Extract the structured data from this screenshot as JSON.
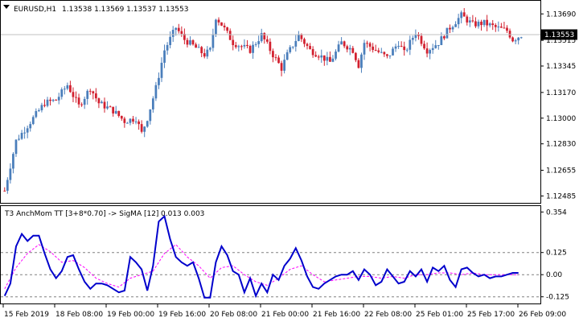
{
  "main_chart": {
    "symbol_label": "EURUSD,H1",
    "ohlc": "1.13538 1.13569 1.13537 1.13553",
    "price_min": 1.1245,
    "price_max": 1.1375,
    "price_ticks": [
      "1.13690",
      "1.13515",
      "1.13345",
      "1.13170",
      "1.13000",
      "1.12830",
      "1.12655",
      "1.12485"
    ],
    "current_price_label": "1.13553",
    "current_price": 1.13553,
    "bull_color": "#4a7ebb",
    "bear_color": "#d2202f"
  },
  "indicator": {
    "name": "T3 AnchMom TT [3+8*0.70] -> SigMA [12]",
    "values_text": "0.013 0.003",
    "levels": [
      "0.354",
      "0.125",
      "0.00",
      "-0.125"
    ],
    "main_color": "#0000cc",
    "signal_color": "#ff00ff"
  },
  "time_axis": {
    "labels": [
      "15 Feb 2019",
      "18 Feb 08:00",
      "19 Feb 00:00",
      "19 Feb 16:00",
      "20 Feb 08:00",
      "21 Feb 00:00",
      "21 Feb 16:00",
      "22 Feb 08:00",
      "25 Feb 01:00",
      "25 Feb 17:00",
      "26 Feb 09:00"
    ]
  },
  "chart_data": [
    {
      "type": "candlestick",
      "title": "EURUSD,H1",
      "ylim": [
        1.1245,
        1.1375
      ],
      "close_path": [
        [
          0,
          1.1252
        ],
        [
          4,
          1.1285
        ],
        [
          10,
          1.13
        ],
        [
          14,
          1.131
        ],
        [
          18,
          1.1312
        ],
        [
          22,
          1.1322
        ],
        [
          26,
          1.1308
        ],
        [
          30,
          1.132
        ],
        [
          33,
          1.131
        ],
        [
          38,
          1.1305
        ],
        [
          42,
          1.1298
        ],
        [
          46,
          1.13
        ],
        [
          48,
          1.129
        ],
        [
          50,
          1.13
        ],
        [
          53,
          1.132
        ],
        [
          56,
          1.1345
        ],
        [
          60,
          1.136
        ],
        [
          63,
          1.1352
        ],
        [
          66,
          1.1348
        ],
        [
          70,
          1.1342
        ],
        [
          72,
          1.1345
        ],
        [
          74,
          1.1367
        ],
        [
          76,
          1.1362
        ],
        [
          80,
          1.135
        ],
        [
          86,
          1.1345
        ],
        [
          90,
          1.1355
        ],
        [
          94,
          1.1342
        ],
        [
          97,
          1.1333
        ],
        [
          99,
          1.1342
        ],
        [
          103,
          1.1355
        ],
        [
          107,
          1.1345
        ],
        [
          110,
          1.1342
        ],
        [
          114,
          1.1337
        ],
        [
          118,
          1.135
        ],
        [
          122,
          1.1345
        ],
        [
          124,
          1.1335
        ],
        [
          126,
          1.135
        ],
        [
          130,
          1.1345
        ],
        [
          134,
          1.134
        ],
        [
          138,
          1.135
        ],
        [
          140,
          1.1343
        ],
        [
          144,
          1.1357
        ],
        [
          148,
          1.1345
        ],
        [
          152,
          1.135
        ],
        [
          156,
          1.136
        ],
        [
          160,
          1.1368
        ],
        [
          164,
          1.1362
        ],
        [
          168,
          1.1363
        ],
        [
          172,
          1.136
        ],
        [
          176,
          1.1358
        ],
        [
          178,
          1.1352
        ],
        [
          181,
          1.1355
        ]
      ]
    },
    {
      "type": "line",
      "title": "T3 AnchMom TT [3+8*0.70] -> SigMA [12]",
      "ylim": [
        -0.14,
        0.36
      ],
      "series": [
        {
          "values": [
            [
              0,
              -0.12
            ],
            [
              2,
              -0.05
            ],
            [
              4,
              0.16
            ],
            [
              6,
              0.23
            ],
            [
              8,
              0.19
            ],
            [
              10,
              0.22
            ],
            [
              12,
              0.22
            ],
            [
              14,
              0.12
            ],
            [
              16,
              0.03
            ],
            [
              18,
              -0.02
            ],
            [
              20,
              0.02
            ],
            [
              22,
              0.1
            ],
            [
              24,
              0.11
            ],
            [
              26,
              0.03
            ],
            [
              28,
              -0.04
            ],
            [
              30,
              -0.08
            ],
            [
              32,
              -0.05
            ],
            [
              34,
              -0.05
            ],
            [
              36,
              -0.06
            ],
            [
              38,
              -0.08
            ],
            [
              40,
              -0.1
            ],
            [
              42,
              -0.09
            ],
            [
              44,
              0.1
            ],
            [
              46,
              0.07
            ],
            [
              48,
              0.03
            ],
            [
              50,
              -0.09
            ],
            [
              52,
              0.05
            ],
            [
              54,
              0.3
            ],
            [
              56,
              0.33
            ],
            [
              58,
              0.2
            ],
            [
              60,
              0.1
            ],
            [
              62,
              0.07
            ],
            [
              64,
              0.05
            ],
            [
              66,
              0.07
            ],
            [
              68,
              -0.02
            ],
            [
              70,
              -0.13
            ],
            [
              72,
              -0.13
            ],
            [
              74,
              0.07
            ],
            [
              76,
              0.16
            ],
            [
              78,
              0.11
            ],
            [
              80,
              0.02
            ],
            [
              82,
              0.0
            ],
            [
              84,
              -0.1
            ],
            [
              86,
              -0.02
            ],
            [
              88,
              -0.12
            ],
            [
              90,
              -0.05
            ],
            [
              92,
              -0.1
            ],
            [
              94,
              0.0
            ],
            [
              96,
              -0.03
            ],
            [
              98,
              0.05
            ],
            [
              100,
              0.09
            ],
            [
              102,
              0.15
            ],
            [
              104,
              0.08
            ],
            [
              106,
              -0.01
            ],
            [
              108,
              -0.07
            ],
            [
              110,
              -0.08
            ],
            [
              112,
              -0.05
            ],
            [
              114,
              -0.03
            ],
            [
              116,
              -0.01
            ],
            [
              118,
              0.0
            ],
            [
              120,
              0.0
            ],
            [
              122,
              0.02
            ],
            [
              124,
              -0.03
            ],
            [
              126,
              0.03
            ],
            [
              128,
              0.0
            ],
            [
              130,
              -0.06
            ],
            [
              132,
              -0.04
            ],
            [
              134,
              0.03
            ],
            [
              136,
              -0.01
            ],
            [
              138,
              -0.05
            ],
            [
              140,
              -0.04
            ],
            [
              142,
              0.02
            ],
            [
              144,
              -0.01
            ],
            [
              146,
              0.03
            ],
            [
              148,
              -0.04
            ],
            [
              150,
              0.04
            ],
            [
              152,
              0.02
            ],
            [
              154,
              0.05
            ],
            [
              156,
              -0.03
            ],
            [
              158,
              -0.07
            ],
            [
              160,
              0.03
            ],
            [
              162,
              0.04
            ],
            [
              164,
              0.01
            ],
            [
              166,
              -0.01
            ],
            [
              168,
              0.0
            ],
            [
              170,
              -0.02
            ],
            [
              172,
              -0.01
            ],
            [
              174,
              -0.01
            ],
            [
              176,
              0.0
            ],
            [
              178,
              0.01
            ],
            [
              180,
              0.01
            ]
          ]
        },
        {
          "values": [
            [
              0,
              -0.08
            ],
            [
              4,
              0.04
            ],
            [
              8,
              0.12
            ],
            [
              12,
              0.17
            ],
            [
              16,
              0.13
            ],
            [
              20,
              0.07
            ],
            [
              24,
              0.08
            ],
            [
              28,
              0.04
            ],
            [
              32,
              -0.02
            ],
            [
              36,
              -0.05
            ],
            [
              40,
              -0.07
            ],
            [
              44,
              -0.02
            ],
            [
              48,
              0.0
            ],
            [
              52,
              0.02
            ],
            [
              56,
              0.12
            ],
            [
              60,
              0.17
            ],
            [
              64,
              0.1
            ],
            [
              68,
              0.05
            ],
            [
              72,
              -0.02
            ],
            [
              76,
              0.04
            ],
            [
              80,
              0.05
            ],
            [
              84,
              0.0
            ],
            [
              88,
              -0.04
            ],
            [
              92,
              -0.06
            ],
            [
              96,
              -0.02
            ],
            [
              100,
              0.03
            ],
            [
              104,
              0.05
            ],
            [
              108,
              0.0
            ],
            [
              112,
              -0.04
            ],
            [
              116,
              -0.03
            ],
            [
              120,
              -0.02
            ],
            [
              124,
              -0.01
            ],
            [
              128,
              -0.01
            ],
            [
              132,
              -0.02
            ],
            [
              136,
              -0.01
            ],
            [
              140,
              -0.02
            ],
            [
              144,
              0.0
            ],
            [
              148,
              0.0
            ],
            [
              152,
              0.01
            ],
            [
              156,
              0.01
            ],
            [
              160,
              0.0
            ],
            [
              164,
              0.01
            ],
            [
              168,
              0.0
            ],
            [
              172,
              0.0
            ],
            [
              176,
              0.0
            ],
            [
              180,
              0.0
            ]
          ]
        }
      ]
    }
  ]
}
